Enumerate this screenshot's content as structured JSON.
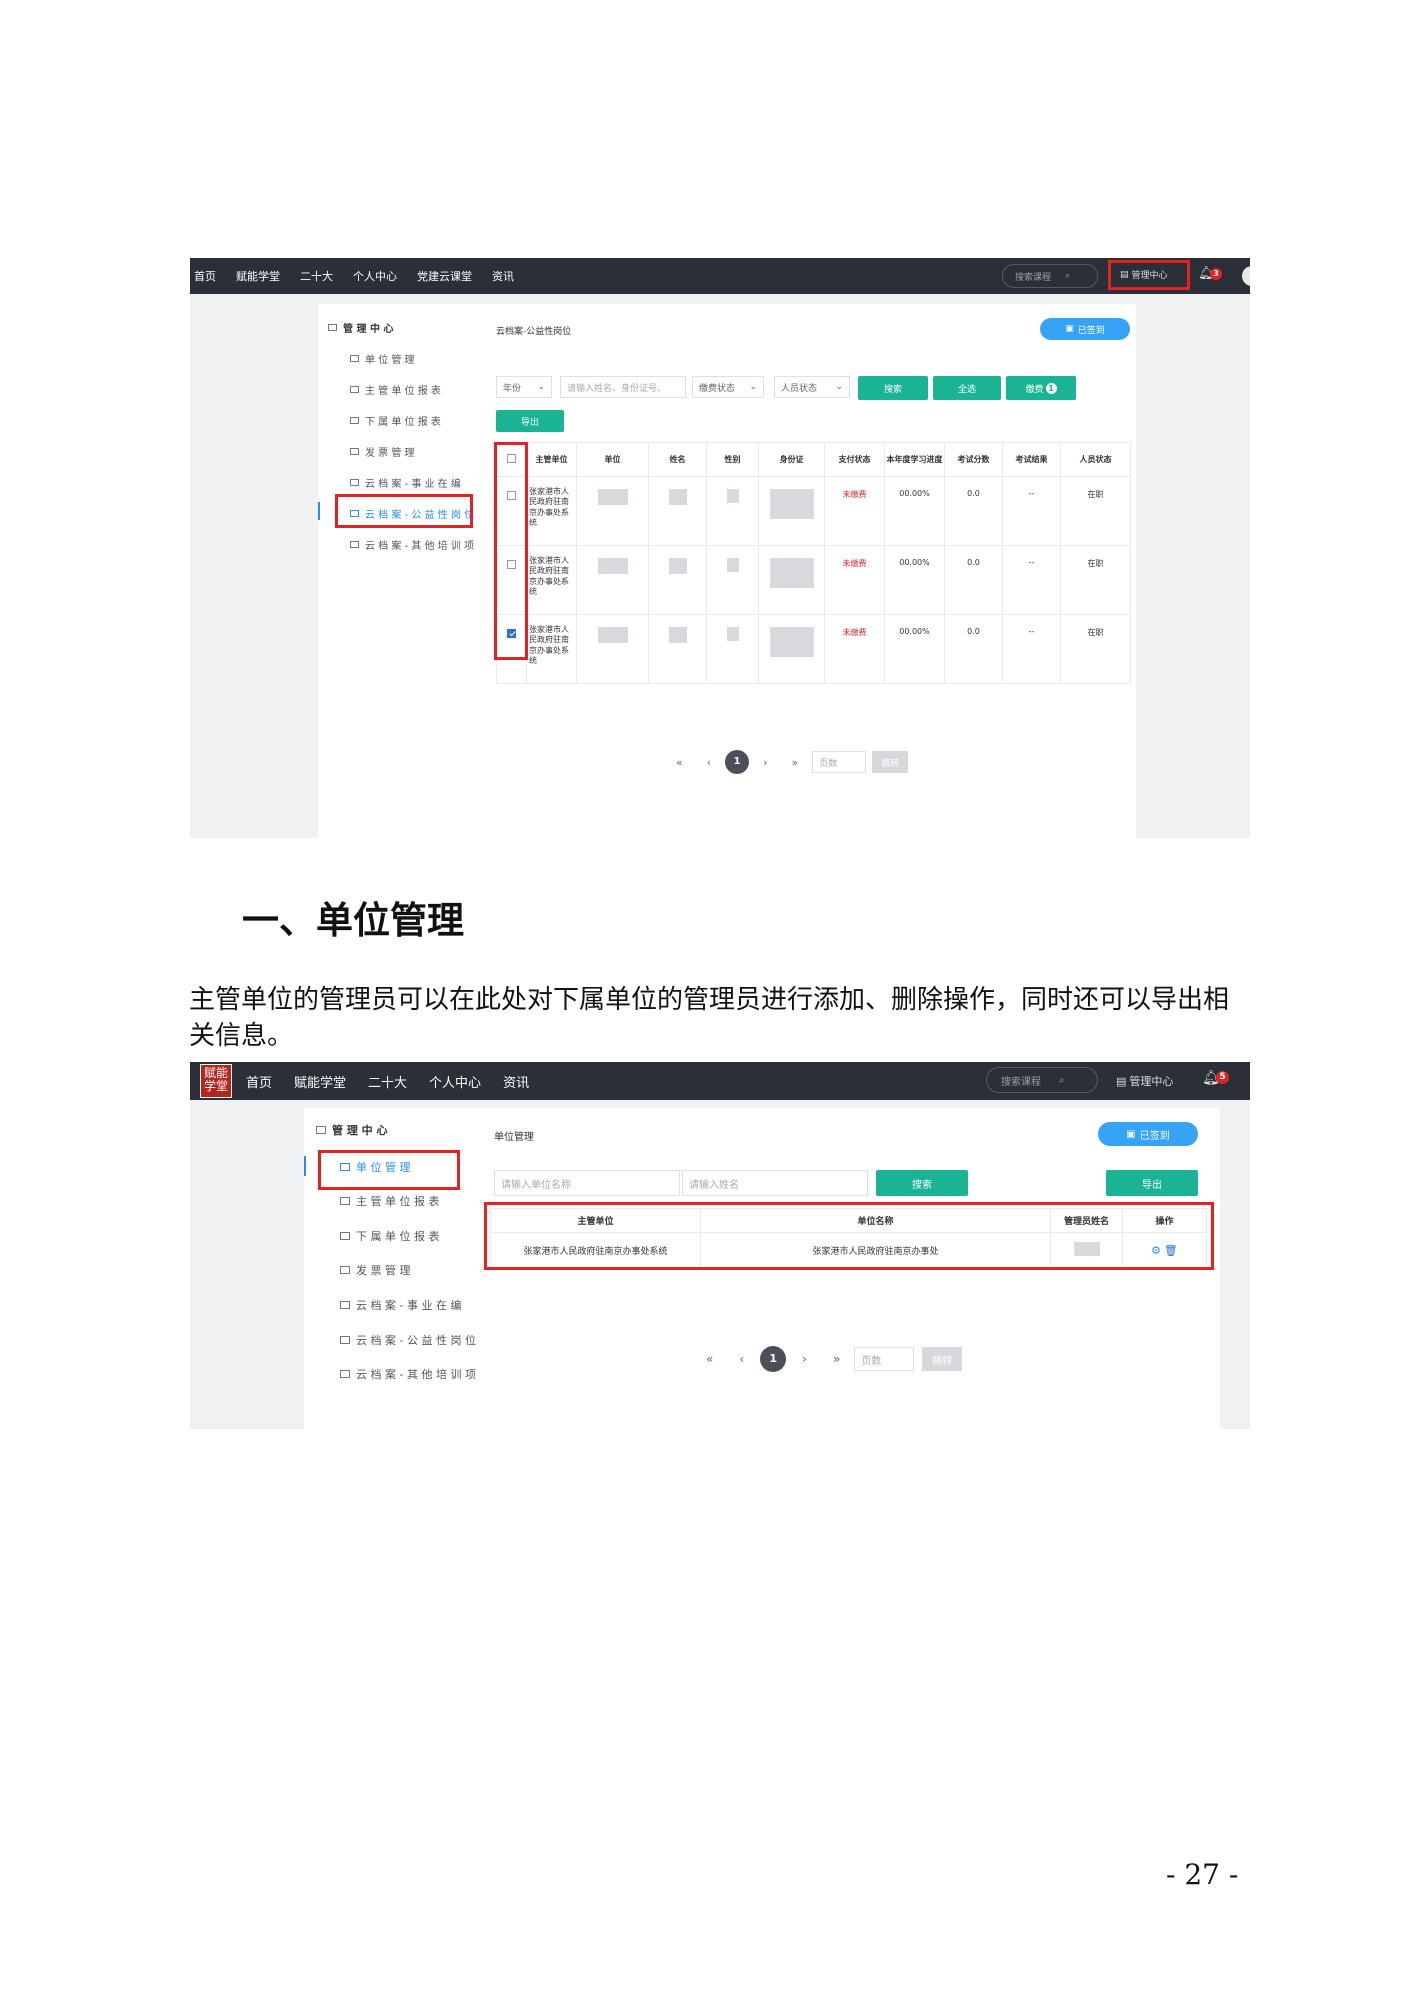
{
  "shot1": {
    "nav": [
      "首页",
      "赋能学堂",
      "二十大",
      "个人中心",
      "党建云课堂",
      "资讯"
    ],
    "search_placeholder": "搜索课程",
    "mgmt_label": "管理中心",
    "bell_count": "3",
    "sidebar_head": "管 理 中 心",
    "sidebar_items": [
      "单 位 管 理",
      "主 管 单 位 报 表",
      "下 属 单 位 报 表",
      "发 票 管 理",
      "云 档 案 - 事 业 在 编",
      "云 档 案 - 公 益 性 岗 位",
      "云 档 案 - 其 他 培 训 项 目"
    ],
    "breadcrumb": "云档案-公益性岗位",
    "signed_label": "已签到",
    "filter_year": "年份",
    "filter_placeholder": "请输入姓名、身份证号、",
    "filter_fee": "缴费状态",
    "filter_person": "人员状态",
    "btn_search": "搜索",
    "btn_all": "全选",
    "btn_pay": "缴费",
    "pay_count": "1",
    "btn_export": "导出",
    "columns": [
      "主管单位",
      "单位",
      "姓名",
      "性别",
      "身份证",
      "支付状态",
      "本年度学习进度",
      "考试分数",
      "考试结果",
      "人员状态"
    ],
    "rows": [
      {
        "org": "张家港市人民政府驻南京办事处系统",
        "pay": "未缴费",
        "progress": "00.00%",
        "score": "0.0",
        "result": "--",
        "status": "在职",
        "checked": false
      },
      {
        "org": "张家港市人民政府驻南京办事处系统",
        "pay": "未缴费",
        "progress": "00.00%",
        "score": "0.0",
        "result": "--",
        "status": "在职",
        "checked": false
      },
      {
        "org": "张家港市人民政府驻南京办事处系统",
        "pay": "未缴费",
        "progress": "00.00%",
        "score": "0.0",
        "result": "--",
        "status": "在职",
        "checked": true
      }
    ],
    "pager_prev2": "«",
    "pager_prev": "‹",
    "pager_current": "1",
    "pager_next": "›",
    "pager_next2": "»",
    "pager_placeholder": "页数",
    "pager_jump": "跳转"
  },
  "heading": "一、单位管理",
  "paragraph": "主管单位的管理员可以在此处对下属单位的管理员进行添加、删除操作，同时还可以导出相关信息。",
  "shot2": {
    "logo": "赋能学堂",
    "nav": [
      "首页",
      "赋能学堂",
      "二十大",
      "个人中心",
      "资讯"
    ],
    "search_placeholder": "搜索课程",
    "mgmt_label": "管理中心",
    "bell_count": "5",
    "sidebar_head": "管 理 中 心",
    "sidebar_items": [
      "单 位 管 理",
      "主 管 单 位 报 表",
      "下 属 单 位 报 表",
      "发 票 管 理",
      "云 档 案 - 事 业 在 编",
      "云 档 案 - 公 益 性 岗 位",
      "云 档 案 - 其 他 培 训 项 目"
    ],
    "breadcrumb": "单位管理",
    "signed_label": "已签到",
    "unit_placeholder": "请输入单位名称",
    "name_placeholder": "请输入姓名",
    "btn_search": "搜索",
    "btn_export": "导出",
    "columns": [
      "主管单位",
      "单位名称",
      "管理员姓名",
      "操作"
    ],
    "rows": [
      {
        "org": "张家港市人民政府驻南京办事处系统",
        "unit": "张家港市人民政府驻南京办事处"
      }
    ],
    "pager_prev2": "«",
    "pager_prev": "‹",
    "pager_current": "1",
    "pager_next": "›",
    "pager_next2": "»",
    "pager_placeholder": "页数",
    "pager_jump": "跳转"
  },
  "page_number": "- 27 -",
  "colors": {
    "accent": "#2a8cf0",
    "green": "#1ab394",
    "highlight": "#e02424",
    "navbar": "#2b2f38"
  }
}
